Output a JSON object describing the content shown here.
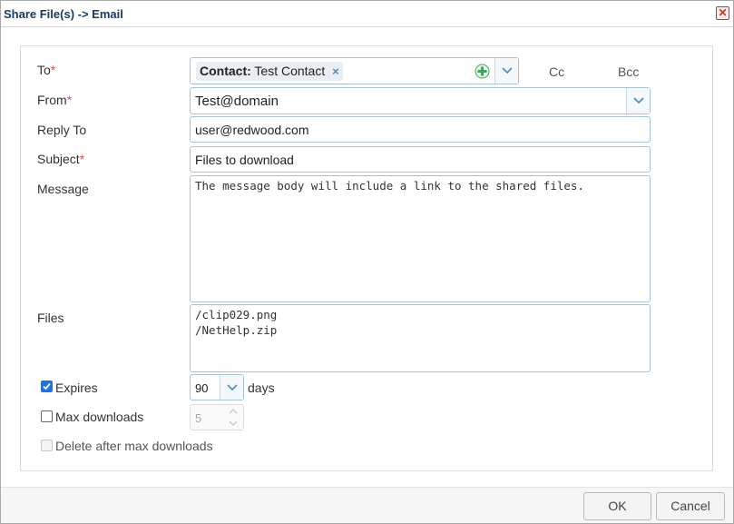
{
  "dialog": {
    "title": "Share File(s) -> Email",
    "close_icon": "close-icon",
    "close_glyph": "✕"
  },
  "form": {
    "to": {
      "label": "To",
      "required_mark": "*",
      "chip_type": "Contact:",
      "chip_value": "Test Contact",
      "chip_remove": "×",
      "cc_label": "Cc",
      "bcc_label": "Bcc"
    },
    "from": {
      "label": "From",
      "required_mark": "*",
      "value": "Test@domain"
    },
    "reply_to": {
      "label": "Reply To",
      "value": "user@redwood.com"
    },
    "subject": {
      "label": "Subject",
      "required_mark": "*",
      "value": "Files to download"
    },
    "message": {
      "label": "Message",
      "value": "The message body will include a link to the shared files."
    },
    "files": {
      "label": "Files",
      "items": [
        "/clip029.png",
        "/NetHelp.zip"
      ]
    },
    "expires": {
      "label": "Expires",
      "checked": true,
      "value": "90",
      "unit": "days"
    },
    "max_downloads": {
      "label": "Max downloads",
      "checked": false,
      "value": "5"
    },
    "delete_after": {
      "label": "Delete after max downloads",
      "checked": false
    }
  },
  "footer": {
    "ok_label": "OK",
    "cancel_label": "Cancel"
  },
  "colors": {
    "title": "#1a3a64",
    "required": "#d9534f",
    "field_border": "#a6c3d6",
    "checkbox_checked": "#1a73e8",
    "add_icon": "#3aa657"
  }
}
